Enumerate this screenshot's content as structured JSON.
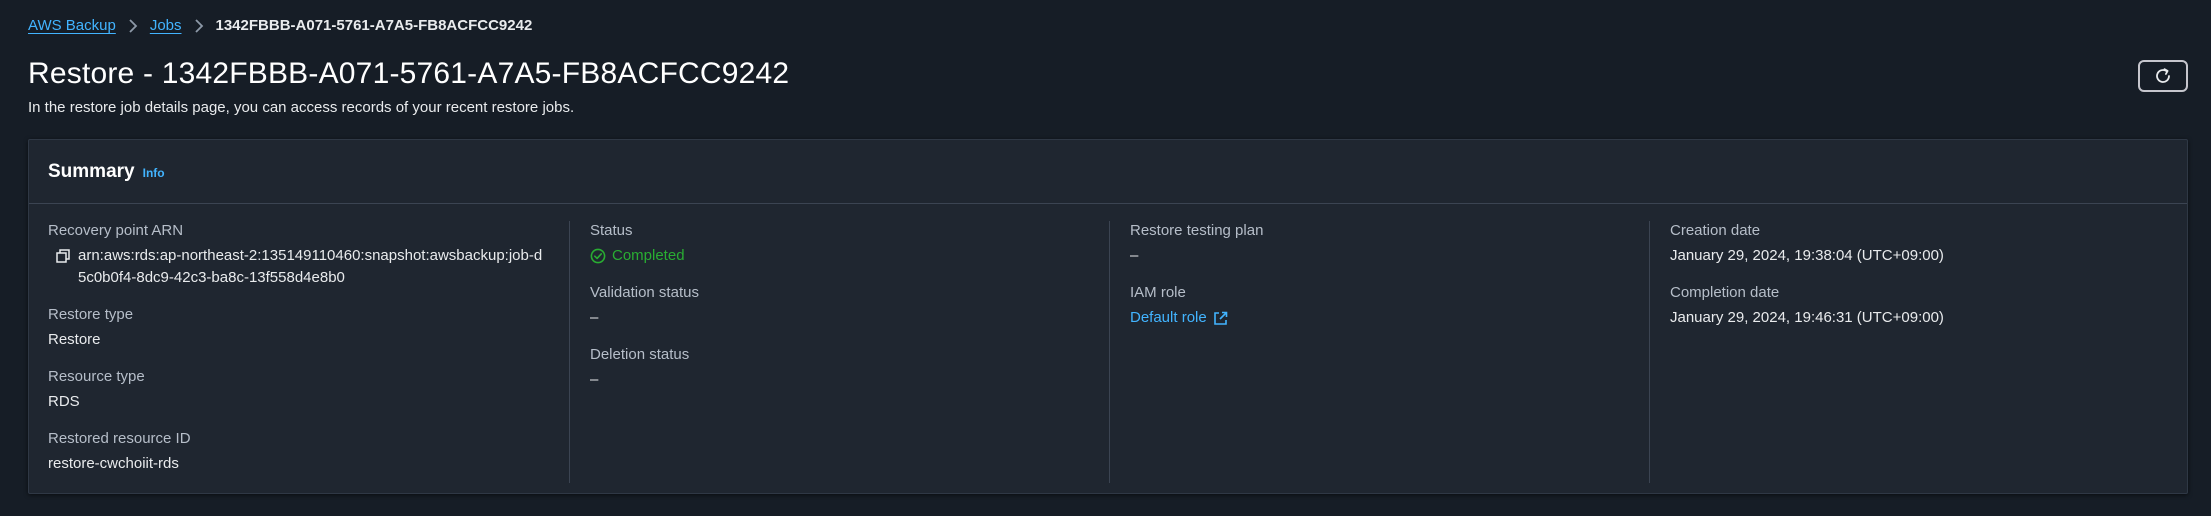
{
  "breadcrumb": {
    "items": [
      "AWS Backup",
      "Jobs"
    ],
    "current": "1342FBBB-A071-5761-A7A5-FB8ACFCC9242"
  },
  "header": {
    "title": "Restore - 1342FBBB-A071-5761-A7A5-FB8ACFCC9242",
    "description": "In the restore job details page, you can access records of your recent restore jobs."
  },
  "summary": {
    "title": "Summary",
    "info_label": "Info",
    "recovery_point_arn": {
      "label": "Recovery point ARN",
      "value": "arn:aws:rds:ap-northeast-2:135149110460:snapshot:awsbackup:job-d5c0b0f4-8dc9-42c3-ba8c-13f558d4e8b0"
    },
    "restore_type": {
      "label": "Restore type",
      "value": "Restore"
    },
    "resource_type": {
      "label": "Resource type",
      "value": "RDS"
    },
    "restored_resource_id": {
      "label": "Restored resource ID",
      "value": "restore-cwchoiit-rds"
    },
    "status": {
      "label": "Status",
      "value": "Completed"
    },
    "validation_status": {
      "label": "Validation status",
      "value": "–"
    },
    "deletion_status": {
      "label": "Deletion status",
      "value": "–"
    },
    "restore_testing_plan": {
      "label": "Restore testing plan",
      "value": "–"
    },
    "iam_role": {
      "label": "IAM role",
      "value": "Default role"
    },
    "creation_date": {
      "label": "Creation date",
      "value": "January 29, 2024, 19:38:04 (UTC+09:00)"
    },
    "completion_date": {
      "label": "Completion date",
      "value": "January 29, 2024, 19:46:31 (UTC+09:00)"
    }
  },
  "colors": {
    "link": "#42b4ff",
    "success": "#29ad32",
    "background": "#161d26",
    "panel": "#1f2630"
  },
  "icons": {
    "breadcrumb_separator": "chevron-right-icon",
    "refresh": "refresh-icon",
    "copy": "copy-icon",
    "status": "check-circle-icon",
    "external": "external-link-icon"
  }
}
